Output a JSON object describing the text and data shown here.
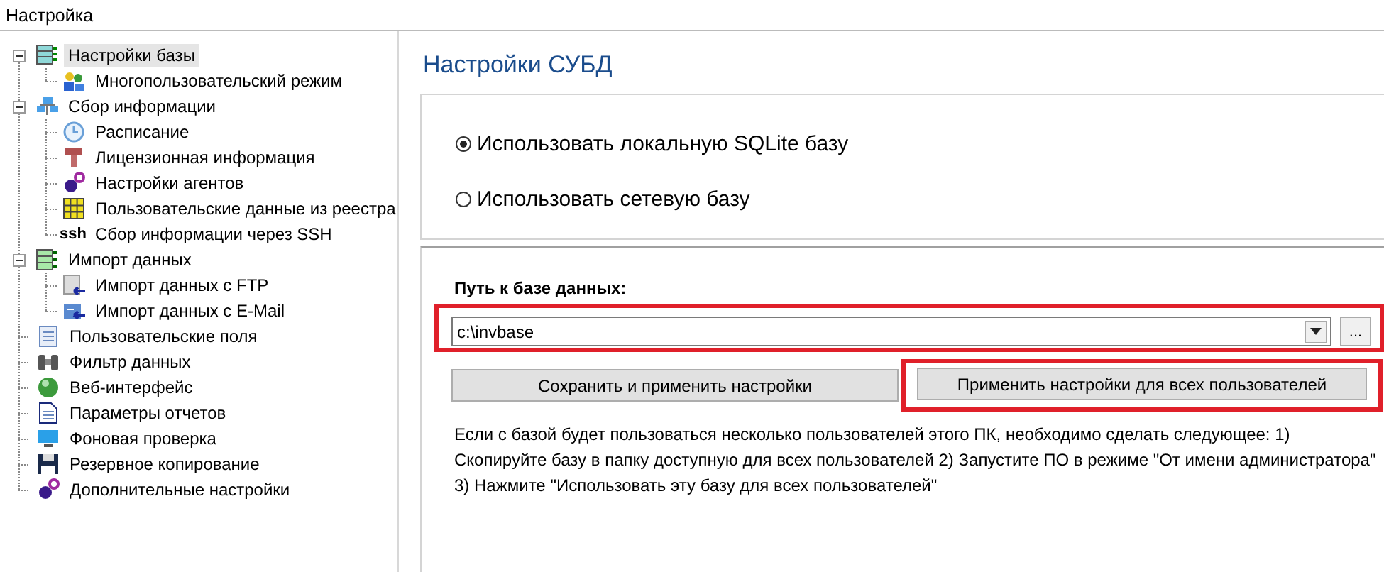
{
  "window": {
    "title": "Настройка"
  },
  "tree": [
    {
      "label": "Настройки базы",
      "selected": true,
      "expanded": true,
      "children": [
        {
          "label": "Многопользовательский режим",
          "selected": false
        }
      ]
    },
    {
      "label": "Сбор информации",
      "selected": false,
      "expanded": true,
      "children": [
        {
          "label": "Расписание",
          "selected": false
        },
        {
          "label": "Лицензионная информация",
          "selected": false
        },
        {
          "label": "Настройки агентов",
          "selected": false
        },
        {
          "label": "Пользовательские данные из реестра",
          "selected": false
        },
        {
          "label": "Сбор информации через SSH",
          "selected": false,
          "prefix": "ssh"
        }
      ]
    },
    {
      "label": "Импорт данных",
      "selected": false,
      "expanded": true,
      "children": [
        {
          "label": "Импорт данных с FTP",
          "selected": false
        },
        {
          "label": "Импорт данных с E-Mail",
          "selected": false
        }
      ]
    },
    {
      "label": "Пользовательские поля",
      "selected": false
    },
    {
      "label": "Фильтр данных",
      "selected": false
    },
    {
      "label": "Веб-интерфейс",
      "selected": false
    },
    {
      "label": "Параметры отчетов",
      "selected": false
    },
    {
      "label": "Фоновая проверка",
      "selected": false
    },
    {
      "label": "Резервное копирование",
      "selected": false
    },
    {
      "label": "Дополнительные настройки",
      "selected": false
    }
  ],
  "panel": {
    "title": "Настройки СУБД",
    "options": [
      {
        "label": "Использовать локальную SQLite базу",
        "selected": true
      },
      {
        "label": "Использовать сетевую базу",
        "selected": false
      }
    ],
    "path_label": "Путь к базе данных:",
    "path_field": {
      "value": "c:\\invbase",
      "highlighted": true
    },
    "browse_button": "...",
    "buttons": [
      {
        "label": "Сохранить и применить настройки",
        "highlighted": false
      },
      {
        "label": "Применить настройки для всех пользователей",
        "highlighted": true
      }
    ],
    "note": [
      "Если с базой будет пользоваться несколько пользователей этого ПК, необходимо сделать следующее: 1)",
      "Скопируйте базу в папку доступную для всех пользователей 2) Запустите ПО в режиме \"От имени администратора\"",
      "3) Нажмите \"Использовать эту базу для всех пользователей\""
    ]
  }
}
